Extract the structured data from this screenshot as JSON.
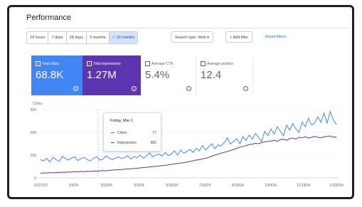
{
  "header": {
    "title": "Performance"
  },
  "date_ranges": [
    "24 hours",
    "7 days",
    "28 days",
    "3 months",
    "16 months"
  ],
  "active_range_index": 4,
  "filters": {
    "search_type": "Search type: Web",
    "add_filter": "Add filter",
    "reset": "Reset filters"
  },
  "metrics": [
    {
      "label": "Total clicks",
      "value": "68.8K",
      "checked": true,
      "color": "#4285f4"
    },
    {
      "label": "Total impressions",
      "value": "1.27M",
      "checked": true,
      "color": "#5e35b1"
    },
    {
      "label": "Average CTR",
      "value": "5.4%",
      "checked": false,
      "color": "#ffffff"
    },
    {
      "label": "Average position",
      "value": "12.4",
      "checked": false,
      "color": "#ffffff"
    }
  ],
  "tooltip": {
    "date": "Friday, Mar 1",
    "clicks_label": "Clicks",
    "clicks_value": "77",
    "impressions_label": "Impressions",
    "impressions_value": "681"
  },
  "chart_data": {
    "type": "line",
    "y_axis_title": "Clicks",
    "ylim": [
      0,
      300
    ],
    "y_ticks": [
      "300",
      "200",
      "100",
      "0"
    ],
    "x_tick_labels": [
      "12/27/23",
      "2/4/24",
      "3/19/24",
      "5/3/24",
      "6/16/24",
      "7/19/24",
      "8/29/24",
      "10/9/24",
      "11/19/24",
      "12/30/24"
    ],
    "series": [
      {
        "name": "Clicks",
        "color": "#4285f4",
        "values": [
          80,
          75,
          85,
          70,
          90,
          80,
          72,
          95,
          85,
          78,
          88,
          92,
          76,
          84,
          90,
          80,
          74,
          86,
          93,
          78,
          82,
          96,
          88,
          80,
          86,
          92,
          85,
          90,
          97,
          82,
          94,
          88,
          100,
          86,
          96,
          110,
          92,
          100,
          105,
          96,
          112,
          98,
          104,
          118,
          100,
          122,
          108,
          115,
          125,
          112,
          130,
          118,
          142,
          122,
          136,
          150,
          128,
          145,
          140,
          155,
          176,
          148,
          160,
          172,
          150,
          182,
          165,
          188,
          170,
          195,
          178,
          160,
          205,
          185,
          215,
          192,
          225,
          205,
          185,
          232,
          210,
          238,
          215,
          200,
          245,
          225,
          262,
          232,
          240,
          268,
          244,
          285,
          240,
          292,
          255,
          235
        ]
      },
      {
        "name": "Impressions",
        "color": "#5e35b1",
        "values": [
          20,
          22,
          21,
          23,
          22,
          24,
          23,
          25,
          24,
          26,
          25,
          27,
          26,
          28,
          27,
          29,
          28,
          30,
          29,
          31,
          32,
          31,
          33,
          34,
          35,
          36,
          37,
          38,
          39,
          40,
          41,
          42,
          44,
          45,
          46,
          48,
          49,
          51,
          52,
          54,
          55,
          57,
          59,
          61,
          63,
          65,
          67,
          70,
          72,
          75,
          78,
          80,
          83,
          86,
          90,
          95,
          100,
          104,
          108,
          112,
          116,
          120,
          125,
          130,
          135,
          138,
          142,
          146,
          148,
          152,
          150,
          155,
          158,
          160,
          162,
          165,
          160,
          168,
          170,
          165,
          172,
          175,
          170,
          178,
          176,
          180,
          175,
          178,
          182,
          178,
          176,
          180,
          182,
          184,
          178,
          180
        ]
      }
    ],
    "grid": true
  }
}
